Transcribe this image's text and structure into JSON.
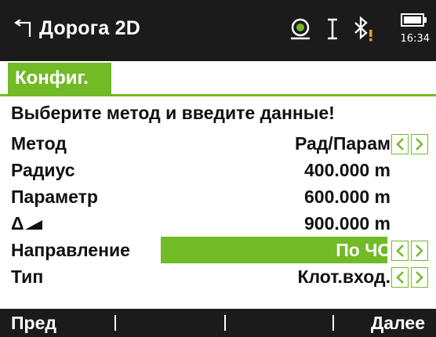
{
  "header": {
    "title": "Дорога 2D",
    "back_icon": "return-arrow-icon",
    "status_icons": [
      "target-prism-icon",
      "text-cursor-icon",
      "bluetooth-warning-icon",
      "battery-icon"
    ],
    "time": "16:34"
  },
  "tab": {
    "label": "Конфиг."
  },
  "instruction": "Выберите метод и введите данные!",
  "rows": [
    {
      "label": "Метод",
      "value": "Рад/Парам",
      "has_arrows": true
    },
    {
      "label": "Радиус",
      "value": "400.000 m"
    },
    {
      "label": "Параметр",
      "value": "600.000 m"
    },
    {
      "label": "Δ",
      "label_icon": "slope-wedge-icon",
      "value": "900.000 m"
    },
    {
      "label": "Направление",
      "value": "По ЧС",
      "has_arrows": true,
      "highlighted": true
    },
    {
      "label": "Тип",
      "value": "Клот.вход.",
      "has_arrows": true
    }
  ],
  "softkeys": {
    "prev": "Пред",
    "next": "Далее"
  },
  "colors": {
    "accent": "#72ba26",
    "bar": "#1b1b1b",
    "text": "#111111"
  }
}
